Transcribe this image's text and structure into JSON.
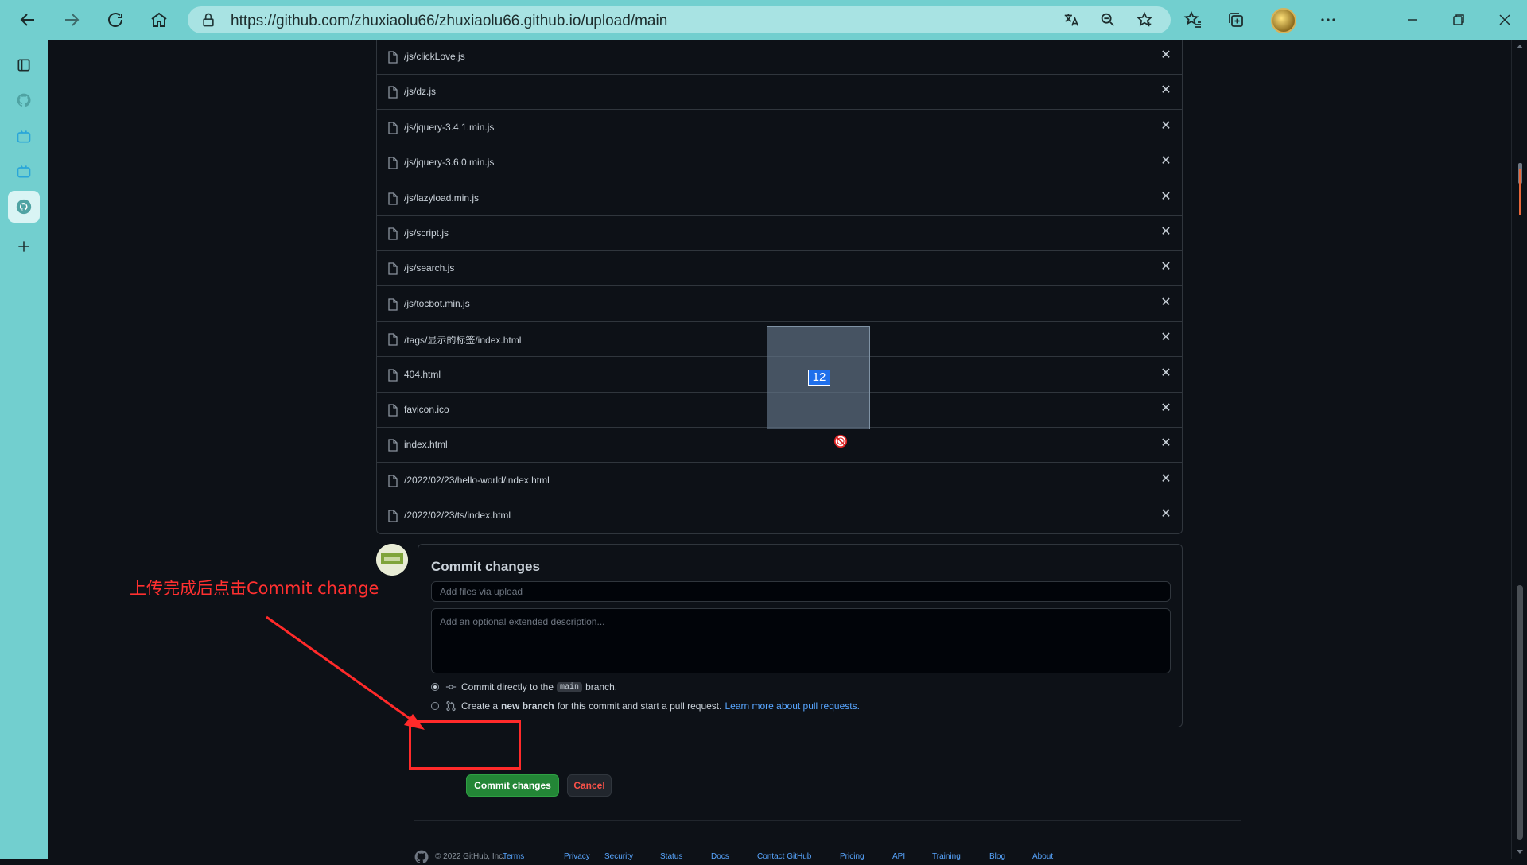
{
  "browser": {
    "url": "https://github.com/zhuxiaolu66/zhuxiaolu66.github.io/upload/main",
    "accent_color": "#72cfcf"
  },
  "files": [
    {
      "name": "/js/clickLove.js"
    },
    {
      "name": "/js/dz.js"
    },
    {
      "name": "/js/jquery-3.4.1.min.js"
    },
    {
      "name": "/js/jquery-3.6.0.min.js"
    },
    {
      "name": "/js/lazyload.min.js"
    },
    {
      "name": "/js/script.js"
    },
    {
      "name": "/js/search.js"
    },
    {
      "name": "/js/tocbot.min.js"
    },
    {
      "name": "/tags/显示的标签/index.html"
    },
    {
      "name": "404.html"
    },
    {
      "name": "favicon.ico"
    },
    {
      "name": "index.html"
    },
    {
      "name": "/2022/02/23/hello-world/index.html"
    },
    {
      "name": "/2022/02/23/ts/index.html"
    }
  ],
  "drag": {
    "count": "12"
  },
  "commit": {
    "title": "Commit changes",
    "summary_placeholder": "Add files via upload",
    "description_placeholder": "Add an optional extended description...",
    "option_direct_prefix": "Commit directly to the",
    "branch_name": "main",
    "option_direct_suffix": "branch.",
    "option_new_prefix": "Create a",
    "option_new_bold": "new branch",
    "option_new_suffix": "for this commit and start a pull request.",
    "option_new_link": "Learn more about pull requests.",
    "submit_label": "Commit changes",
    "cancel_label": "Cancel"
  },
  "annotation": {
    "text": "上传完成后点击Commit change",
    "color": "#ff2a2a"
  },
  "footer": {
    "copyright": "© 2022 GitHub, Inc.",
    "links": [
      "Terms",
      "Privacy",
      "Security",
      "Status",
      "Docs",
      "Contact GitHub",
      "Pricing",
      "API",
      "Training",
      "Blog",
      "About"
    ]
  }
}
